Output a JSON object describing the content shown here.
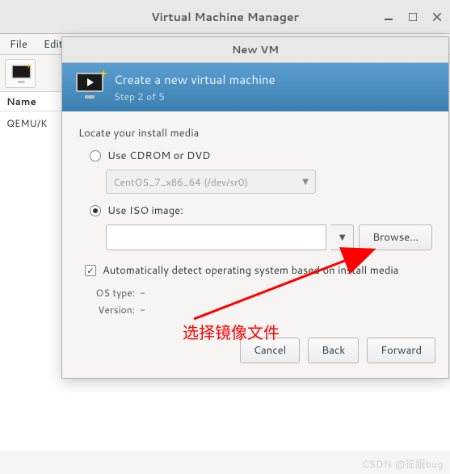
{
  "main": {
    "title": "Virtual Machine Manager",
    "menu": {
      "file": "File",
      "edit": "Edit"
    },
    "column_name": "Name",
    "list_item": "QEMU/K"
  },
  "dialog": {
    "title": "New VM",
    "header_title": "Create a new virtual machine",
    "header_step": "Step 2 of 5",
    "locate_label": "Locate your install media",
    "radio_cdrom": "Use CDROM or DVD",
    "cdrom_combo": "CentOS_7_x86_64 (/dev/sr0)",
    "radio_iso": "Use ISO image:",
    "browse": "Browse...",
    "autodetect": "Automatically detect operating system based on install media",
    "os_type_label": "OS type:",
    "os_type_value": "-",
    "version_label": "Version:",
    "version_value": "-",
    "cancel": "Cancel",
    "back": "Back",
    "forward": "Forward"
  },
  "annotation": {
    "label": "选择镜像文件"
  },
  "watermark": "CSDN @征服bug"
}
